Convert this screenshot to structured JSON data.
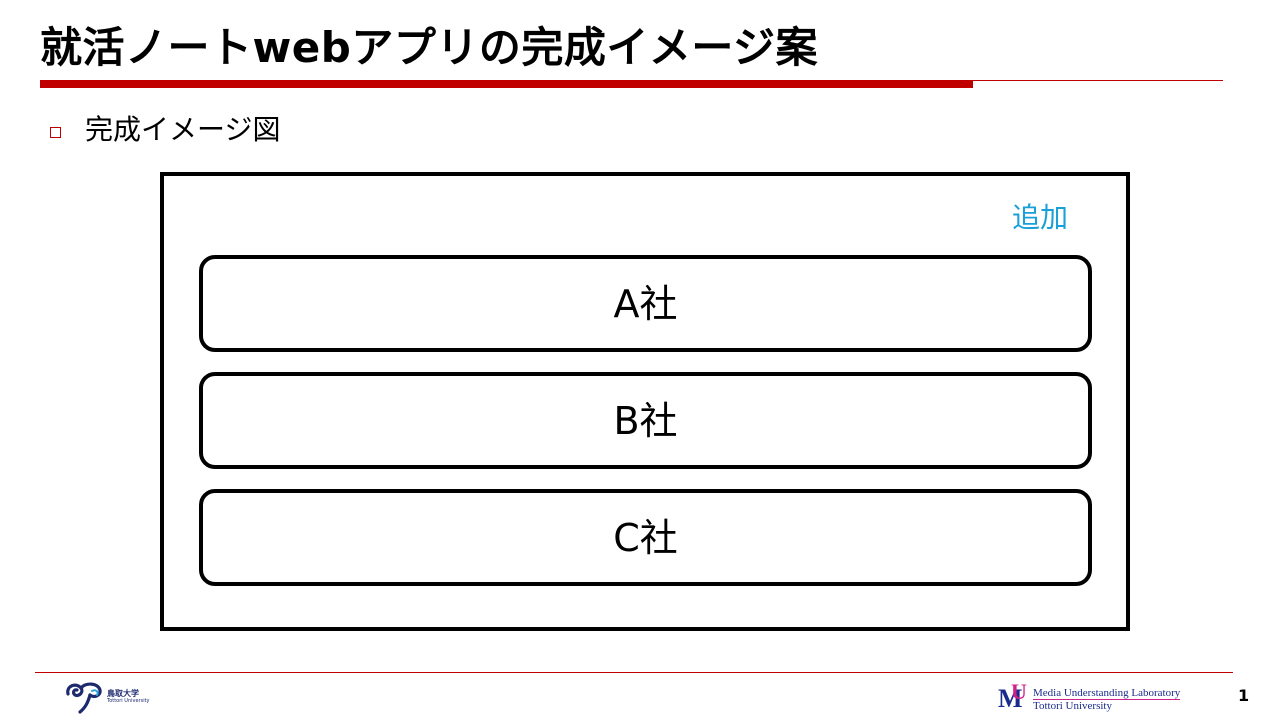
{
  "slide": {
    "title": "就活ノートwebアプリの完成イメージ案",
    "bullet": "完成イメージ図",
    "page_number": "1"
  },
  "mockup": {
    "add_label": "追加",
    "companies": [
      {
        "label": "A社"
      },
      {
        "label": "B社"
      },
      {
        "label": "C社"
      }
    ]
  },
  "footer": {
    "university_name_jp": "鳥取大学",
    "university_name_en": "Tottori University",
    "lab_name": "Media Understanding Laboratory",
    "lab_university": "Tottori University",
    "lab_mark_letters": [
      "M",
      "U"
    ]
  },
  "colors": {
    "accent_red": "#c00000",
    "link_blue": "#1aa0d8",
    "lab_blue": "#1a2b8c",
    "lab_magenta": "#d0208a"
  },
  "icons": {
    "bullet": "hollow-square-bullet-icon",
    "university_logo": "tottori-university-logo-icon",
    "lab_logo": "mu-lab-logo-icon"
  }
}
